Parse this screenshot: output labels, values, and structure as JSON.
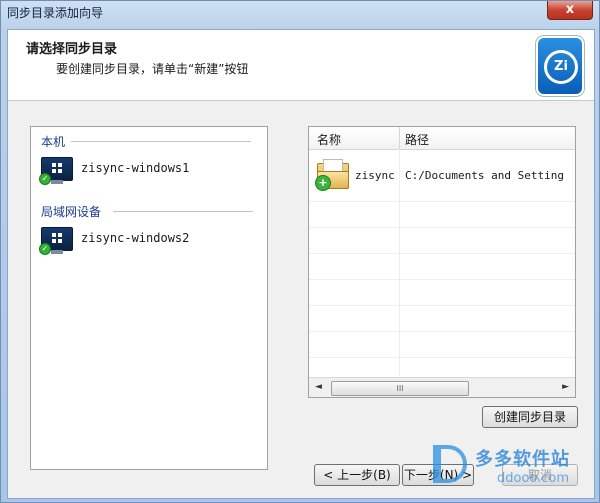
{
  "window": {
    "title": "同步目录添加向导",
    "close_label": "x"
  },
  "header": {
    "title": "请选择同步目录",
    "subtitle": "要创建同步目录，请单击“新建”按钮",
    "logo_text": "Zi"
  },
  "left_panel": {
    "groups": [
      {
        "label": "本机",
        "devices": [
          {
            "name": "zisync-windows1",
            "icon": "computer-icon"
          }
        ]
      },
      {
        "label": "局域网设备",
        "devices": [
          {
            "name": "zisync-windows2",
            "icon": "computer-icon"
          }
        ]
      }
    ]
  },
  "right_panel": {
    "columns": [
      "名称",
      "路径"
    ],
    "rows": [
      {
        "name": "zisync",
        "path": "C:/Documents and Setting",
        "icon": "folder-add-icon"
      }
    ],
    "scroll_left": "◄",
    "scroll_right": "►",
    "scroll_grip": "III"
  },
  "buttons": {
    "create": "创建同步目录",
    "back": "< 上一步(B)",
    "next": "下一步(N) >",
    "cancel": "取消"
  },
  "watermark": {
    "name": "多多软件站",
    "url": "ddooo.com"
  },
  "colors": {
    "accent": "#1e3c8f",
    "logo_blue": "#0a5fb8",
    "status_green": "#34b233"
  }
}
